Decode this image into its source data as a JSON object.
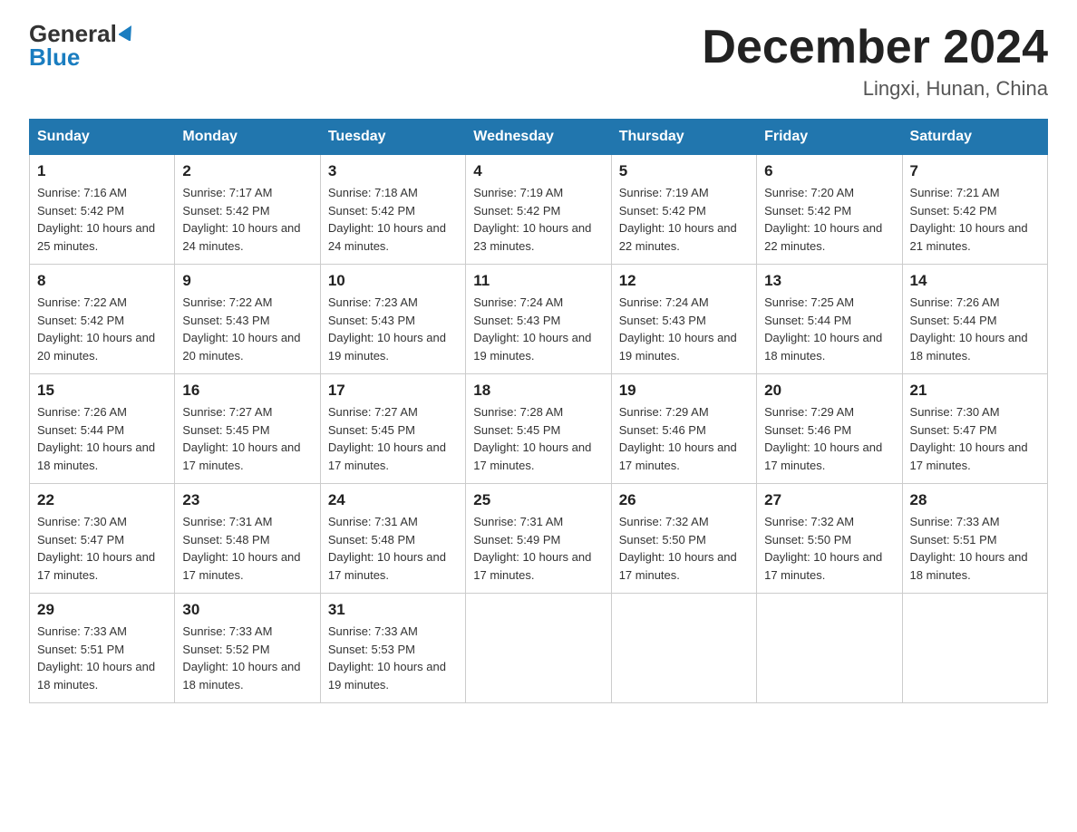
{
  "logo": {
    "general": "General",
    "arrow": "▲",
    "blue": "Blue"
  },
  "title": "December 2024",
  "subtitle": "Lingxi, Hunan, China",
  "weekdays": [
    "Sunday",
    "Monday",
    "Tuesday",
    "Wednesday",
    "Thursday",
    "Friday",
    "Saturday"
  ],
  "weeks": [
    [
      {
        "day": "1",
        "sunrise": "7:16 AM",
        "sunset": "5:42 PM",
        "daylight": "10 hours and 25 minutes."
      },
      {
        "day": "2",
        "sunrise": "7:17 AM",
        "sunset": "5:42 PM",
        "daylight": "10 hours and 24 minutes."
      },
      {
        "day": "3",
        "sunrise": "7:18 AM",
        "sunset": "5:42 PM",
        "daylight": "10 hours and 24 minutes."
      },
      {
        "day": "4",
        "sunrise": "7:19 AM",
        "sunset": "5:42 PM",
        "daylight": "10 hours and 23 minutes."
      },
      {
        "day": "5",
        "sunrise": "7:19 AM",
        "sunset": "5:42 PM",
        "daylight": "10 hours and 22 minutes."
      },
      {
        "day": "6",
        "sunrise": "7:20 AM",
        "sunset": "5:42 PM",
        "daylight": "10 hours and 22 minutes."
      },
      {
        "day": "7",
        "sunrise": "7:21 AM",
        "sunset": "5:42 PM",
        "daylight": "10 hours and 21 minutes."
      }
    ],
    [
      {
        "day": "8",
        "sunrise": "7:22 AM",
        "sunset": "5:42 PM",
        "daylight": "10 hours and 20 minutes."
      },
      {
        "day": "9",
        "sunrise": "7:22 AM",
        "sunset": "5:43 PM",
        "daylight": "10 hours and 20 minutes."
      },
      {
        "day": "10",
        "sunrise": "7:23 AM",
        "sunset": "5:43 PM",
        "daylight": "10 hours and 19 minutes."
      },
      {
        "day": "11",
        "sunrise": "7:24 AM",
        "sunset": "5:43 PM",
        "daylight": "10 hours and 19 minutes."
      },
      {
        "day": "12",
        "sunrise": "7:24 AM",
        "sunset": "5:43 PM",
        "daylight": "10 hours and 19 minutes."
      },
      {
        "day": "13",
        "sunrise": "7:25 AM",
        "sunset": "5:44 PM",
        "daylight": "10 hours and 18 minutes."
      },
      {
        "day": "14",
        "sunrise": "7:26 AM",
        "sunset": "5:44 PM",
        "daylight": "10 hours and 18 minutes."
      }
    ],
    [
      {
        "day": "15",
        "sunrise": "7:26 AM",
        "sunset": "5:44 PM",
        "daylight": "10 hours and 18 minutes."
      },
      {
        "day": "16",
        "sunrise": "7:27 AM",
        "sunset": "5:45 PM",
        "daylight": "10 hours and 17 minutes."
      },
      {
        "day": "17",
        "sunrise": "7:27 AM",
        "sunset": "5:45 PM",
        "daylight": "10 hours and 17 minutes."
      },
      {
        "day": "18",
        "sunrise": "7:28 AM",
        "sunset": "5:45 PM",
        "daylight": "10 hours and 17 minutes."
      },
      {
        "day": "19",
        "sunrise": "7:29 AM",
        "sunset": "5:46 PM",
        "daylight": "10 hours and 17 minutes."
      },
      {
        "day": "20",
        "sunrise": "7:29 AM",
        "sunset": "5:46 PM",
        "daylight": "10 hours and 17 minutes."
      },
      {
        "day": "21",
        "sunrise": "7:30 AM",
        "sunset": "5:47 PM",
        "daylight": "10 hours and 17 minutes."
      }
    ],
    [
      {
        "day": "22",
        "sunrise": "7:30 AM",
        "sunset": "5:47 PM",
        "daylight": "10 hours and 17 minutes."
      },
      {
        "day": "23",
        "sunrise": "7:31 AM",
        "sunset": "5:48 PM",
        "daylight": "10 hours and 17 minutes."
      },
      {
        "day": "24",
        "sunrise": "7:31 AM",
        "sunset": "5:48 PM",
        "daylight": "10 hours and 17 minutes."
      },
      {
        "day": "25",
        "sunrise": "7:31 AM",
        "sunset": "5:49 PM",
        "daylight": "10 hours and 17 minutes."
      },
      {
        "day": "26",
        "sunrise": "7:32 AM",
        "sunset": "5:50 PM",
        "daylight": "10 hours and 17 minutes."
      },
      {
        "day": "27",
        "sunrise": "7:32 AM",
        "sunset": "5:50 PM",
        "daylight": "10 hours and 17 minutes."
      },
      {
        "day": "28",
        "sunrise": "7:33 AM",
        "sunset": "5:51 PM",
        "daylight": "10 hours and 18 minutes."
      }
    ],
    [
      {
        "day": "29",
        "sunrise": "7:33 AM",
        "sunset": "5:51 PM",
        "daylight": "10 hours and 18 minutes."
      },
      {
        "day": "30",
        "sunrise": "7:33 AM",
        "sunset": "5:52 PM",
        "daylight": "10 hours and 18 minutes."
      },
      {
        "day": "31",
        "sunrise": "7:33 AM",
        "sunset": "5:53 PM",
        "daylight": "10 hours and 19 minutes."
      },
      null,
      null,
      null,
      null
    ]
  ]
}
